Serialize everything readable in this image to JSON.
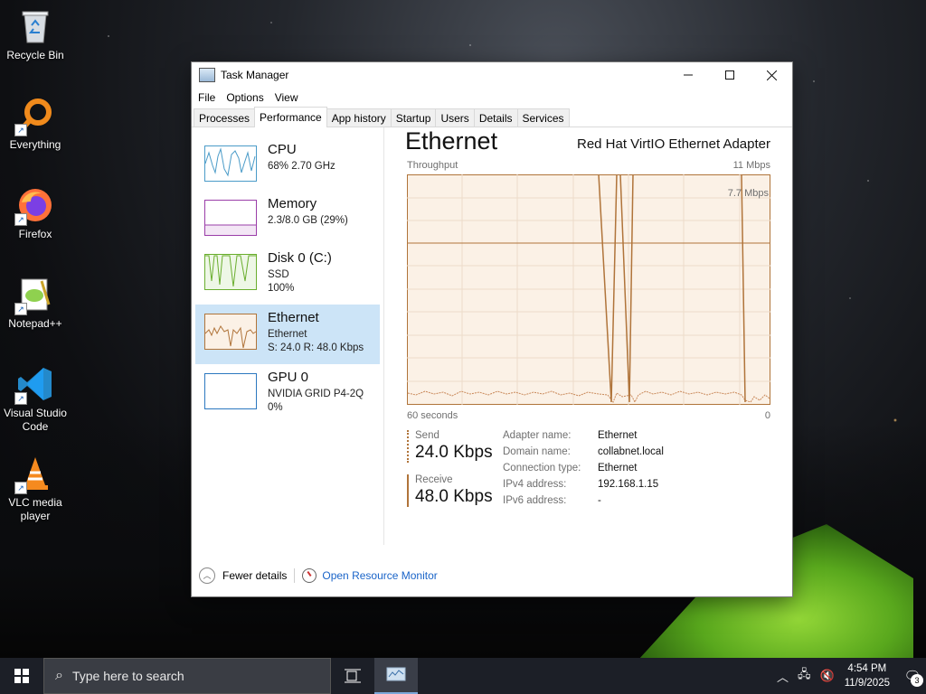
{
  "desktop": {
    "icons": [
      {
        "label": "Recycle Bin"
      },
      {
        "label": "Everything"
      },
      {
        "label": "Firefox"
      },
      {
        "label": "Notepad++"
      },
      {
        "label": "Visual Studio Code"
      },
      {
        "label": "VLC media player"
      }
    ]
  },
  "window": {
    "title": "Task Manager",
    "menu": [
      "File",
      "Options",
      "View"
    ],
    "tabs": [
      "Processes",
      "Performance",
      "App history",
      "Startup",
      "Users",
      "Details",
      "Services"
    ],
    "active_tab": "Performance"
  },
  "sidebar": {
    "items": [
      {
        "title": "CPU",
        "line1": "68%  2.70 GHz",
        "line2": ""
      },
      {
        "title": "Memory",
        "line1": "2.3/8.0 GB (29%)",
        "line2": ""
      },
      {
        "title": "Disk 0 (C:)",
        "line1": "SSD",
        "line2": "100%"
      },
      {
        "title": "Ethernet",
        "line1": "Ethernet",
        "line2": "S: 24.0  R: 48.0 Kbps"
      },
      {
        "title": "GPU 0",
        "line1": "NVIDIA GRID P4-2Q",
        "line2": "0%"
      }
    ],
    "selected": "Ethernet"
  },
  "detail": {
    "heading": "Ethernet",
    "adapter": "Red Hat VirtIO Ethernet Adapter",
    "graph": {
      "label": "Throughput",
      "max_label": "11 Mbps",
      "mid_label": "7.7 Mbps",
      "time_label": "60 seconds",
      "zero_label": "0"
    },
    "send": {
      "label": "Send",
      "value": "24.0 Kbps"
    },
    "receive": {
      "label": "Receive",
      "value": "48.0 Kbps"
    },
    "properties": [
      {
        "key": "Adapter name:",
        "value": "Ethernet"
      },
      {
        "key": "Domain name:",
        "value": "collabnet.local"
      },
      {
        "key": "Connection type:",
        "value": "Ethernet"
      },
      {
        "key": "IPv4 address:",
        "value": "192.168.1.15"
      },
      {
        "key": "IPv6 address:",
        "value": "-"
      }
    ]
  },
  "footer": {
    "fewer_details": "Fewer details",
    "resource_monitor": "Open Resource Monitor"
  },
  "taskbar": {
    "search_placeholder": "Type here to search",
    "time": "4:54 PM",
    "date": "11/9/2025",
    "notification_count": "3"
  },
  "colors": {
    "ethernet_line": "#b0743a",
    "ethernet_fill": "#fbf1e6",
    "cpu": "#4a9bc8",
    "memory": "#9a3da8",
    "disk": "#6aae2e",
    "gpu": "#2c78c0",
    "selected_bg": "#cce4f7"
  }
}
